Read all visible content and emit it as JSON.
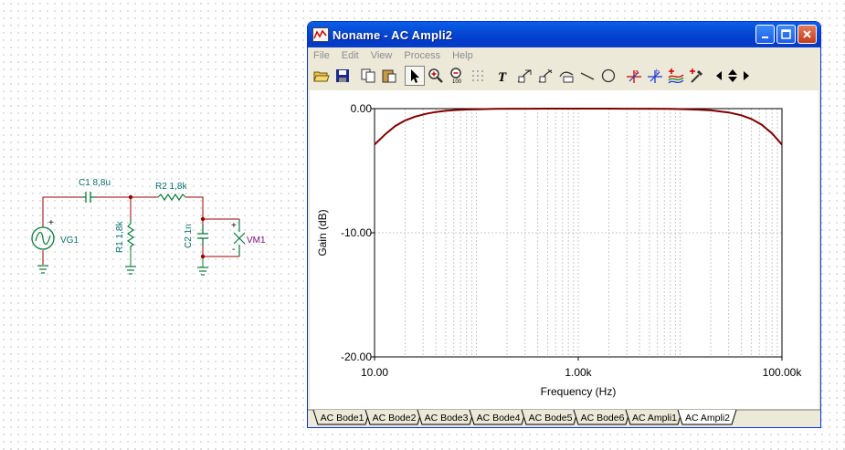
{
  "schematic": {
    "c1_label": "C1 8,8u",
    "r2_label": "R2 1,8k",
    "r1_label": "R1 1,8k",
    "c2_label": "C2 1n",
    "vg1_label": "VG1",
    "vm1_label": "VM1",
    "plus": "+",
    "minus": "-"
  },
  "window": {
    "title": "Noname - AC Ampli2",
    "menu": [
      "File",
      "Edit",
      "View",
      "Process",
      "Help"
    ],
    "toolbar_icons": [
      "open-icon",
      "save-icon",
      "copy-icon",
      "paste-icon",
      "pointer-icon",
      "zoom-in-icon",
      "zoom-100-icon",
      "grid-icon",
      "text-icon",
      "cursor-label-icon",
      "cursor-label2-icon",
      "cursor-label3-icon",
      "line-icon",
      "ellipse-icon",
      "cursor-a-icon",
      "cursor-b-icon",
      "add-curve-icon",
      "add-marker-icon",
      "scroll-arrows-icon"
    ],
    "tabs": [
      "AC Bode1",
      "AC Bode2",
      "AC Bode3",
      "AC Bode4",
      "AC Bode5",
      "AC Bode6",
      "AC Ampli1",
      "AC Ampli2"
    ],
    "active_tab": "AC Ampli2"
  },
  "chart_data": {
    "type": "line",
    "xlabel": "Frequency (Hz)",
    "ylabel": "Gain (dB)",
    "x_scale": "log",
    "xlim": [
      10,
      100000
    ],
    "ylim": [
      -20,
      0
    ],
    "x_ticks": [
      "10.00",
      "1.00k",
      "100.00k"
    ],
    "y_ticks": [
      "0.00",
      "-10.00",
      "-20.00"
    ],
    "grid": true,
    "line_color": "#800000",
    "series": [
      {
        "x": [
          10,
          13,
          16,
          20,
          25,
          32,
          40,
          50,
          63,
          80,
          100,
          150,
          200,
          300,
          500,
          1000,
          2000,
          3000,
          5000,
          8000,
          10000,
          15000,
          20000,
          30000,
          40000,
          50000,
          63000,
          80000,
          100000
        ],
        "values": [
          -2.9,
          -2.0,
          -1.4,
          -0.95,
          -0.65,
          -0.42,
          -0.27,
          -0.18,
          -0.11,
          -0.07,
          -0.05,
          -0.02,
          -0.01,
          -0.01,
          0.0,
          0.0,
          0.0,
          -0.01,
          -0.01,
          -0.02,
          -0.04,
          -0.08,
          -0.14,
          -0.31,
          -0.54,
          -0.83,
          -1.29,
          -2.0,
          -2.9
        ]
      }
    ]
  }
}
